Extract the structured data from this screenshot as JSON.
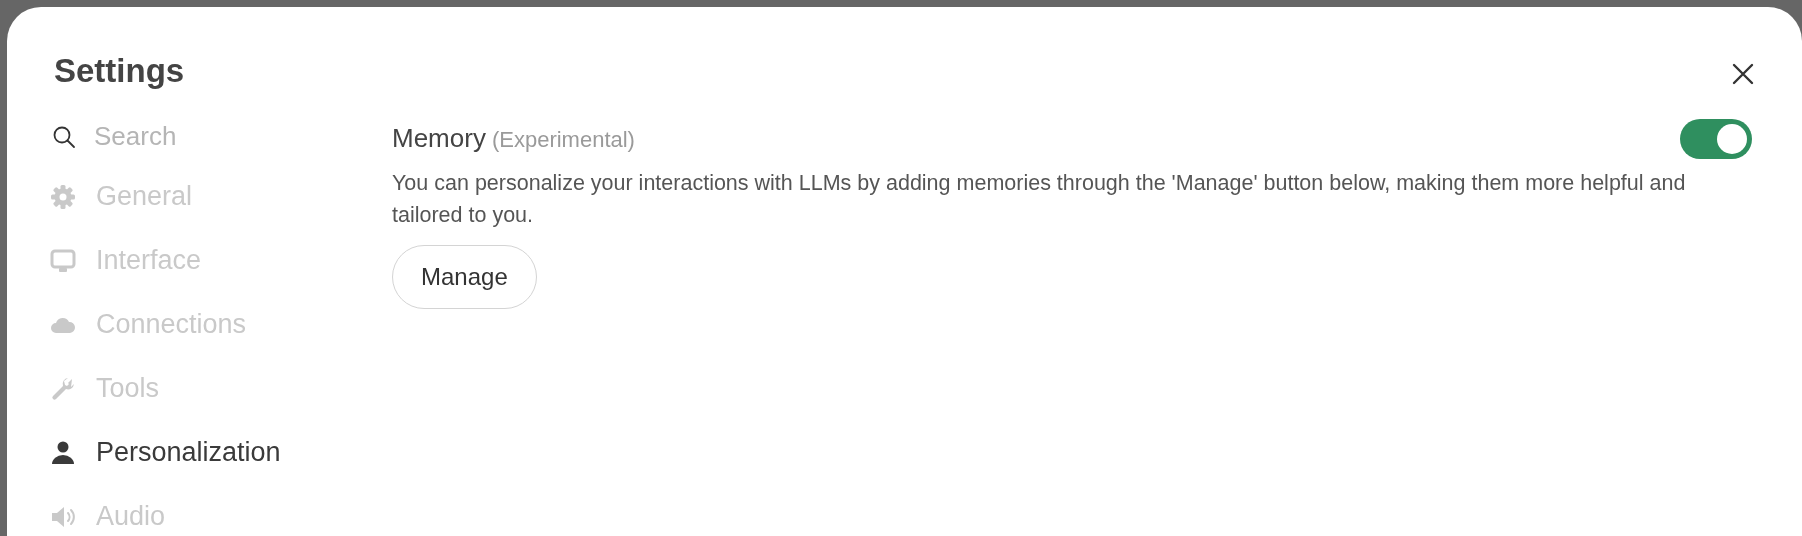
{
  "window": {
    "title": "Settings"
  },
  "sidebar": {
    "search": {
      "placeholder": "Search"
    },
    "items": [
      {
        "label": "General",
        "selected": false
      },
      {
        "label": "Interface",
        "selected": false
      },
      {
        "label": "Connections",
        "selected": false
      },
      {
        "label": "Tools",
        "selected": false
      },
      {
        "label": "Personalization",
        "selected": true
      },
      {
        "label": "Audio",
        "selected": false
      }
    ]
  },
  "memory": {
    "title": "Memory",
    "tag": "(Experimental)",
    "on": true,
    "description": "You can personalize your interactions with LLMs by adding memories through the 'Manage' button below, making them more helpful and tailored to you.",
    "button": "Manage"
  }
}
